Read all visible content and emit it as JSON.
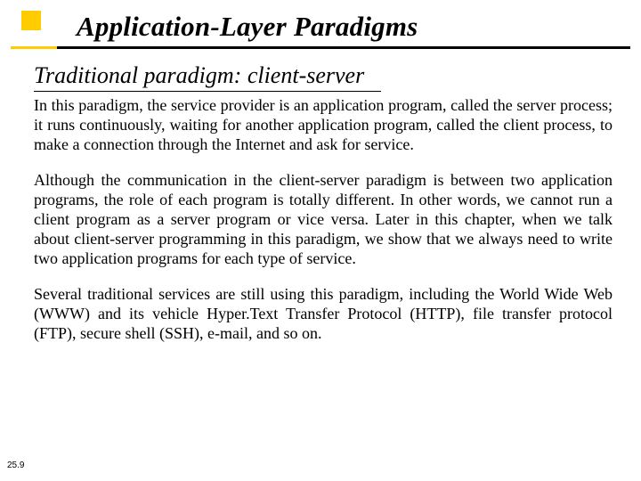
{
  "title": "Application-Layer Paradigms",
  "subtitle": "Traditional paradigm: client-server",
  "paragraphs": {
    "p1": "In this paradigm, the service provider is an application program, called the server process; it runs continuously, waiting for another application program, called the client process, to make a connection through the Internet and ask for service.",
    "p2": "Although the communication in the client-server paradigm is between two application programs, the role of each program is totally different. In other words, we cannot run a client program as a server program or vice versa. Later in this chapter, when we talk about client-server programming in this paradigm, we show that we always need to write two application programs for each type of service.",
    "p3": "Several traditional services are still using this paradigm, including the World Wide Web (WWW) and its vehicle Hyper.Text Transfer Protocol (HTTP), file transfer protocol (FTP), secure shell (SSH), e-mail, and so on."
  },
  "page_number": "25.9"
}
